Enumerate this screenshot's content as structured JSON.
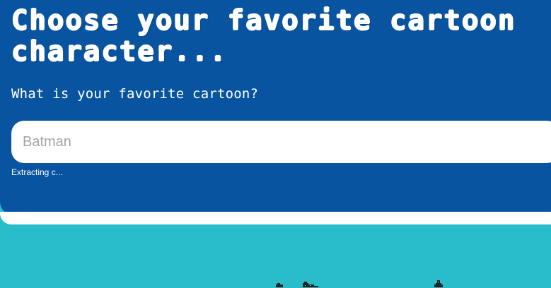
{
  "header": {
    "title": "Choose your favorite cartoon character..."
  },
  "form": {
    "question": "What is your favorite cartoon?",
    "placeholder": "Batman",
    "status": "Extracting c..."
  },
  "colors": {
    "header_bg": "#0854a0",
    "page_bg": "#29bcc9",
    "accent_white": "#ffffff"
  },
  "icons": {
    "bottom_left": "pixel-character-icon",
    "bottom_right": "pixel-character-icon"
  }
}
